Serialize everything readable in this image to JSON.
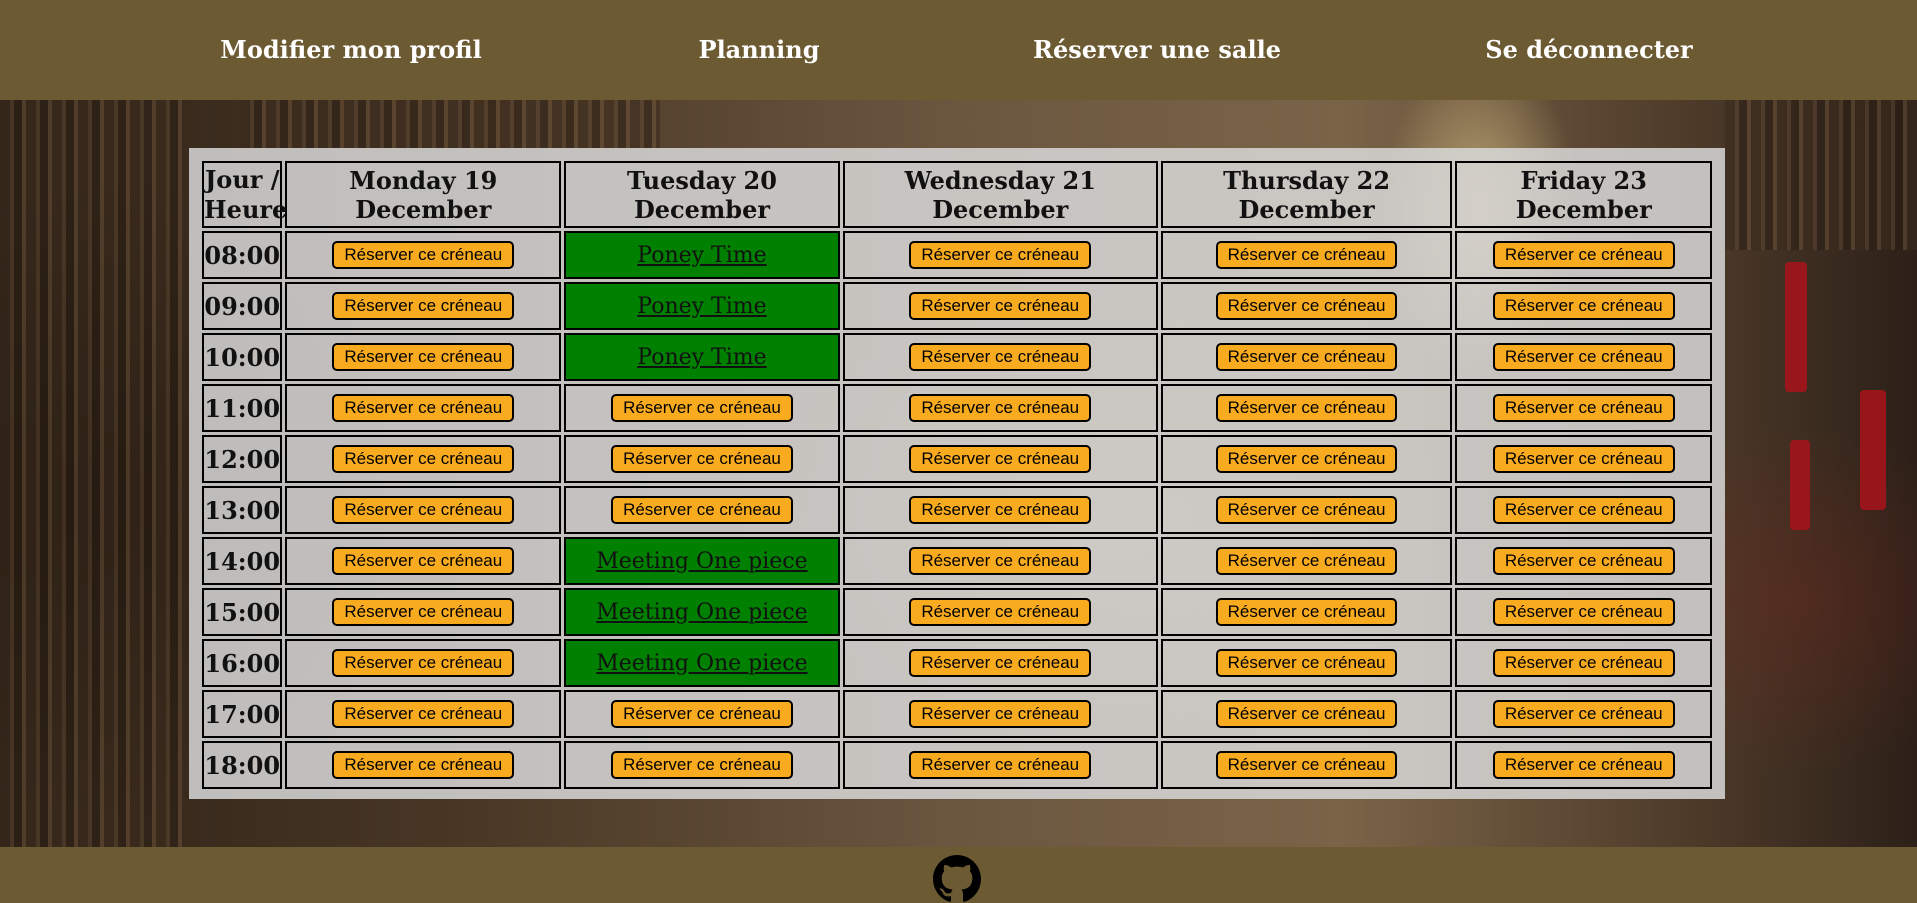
{
  "nav": {
    "items": [
      {
        "label": "Modifier mon profil"
      },
      {
        "label": "Planning"
      },
      {
        "label": "Réserver une salle"
      },
      {
        "label": "Se déconnecter"
      }
    ]
  },
  "planning": {
    "corner_label": "Jour / Heure",
    "days": [
      "Monday 19 December",
      "Tuesday 20 December",
      "Wednesday 21 December",
      "Thursday 22 December",
      "Friday 23 December"
    ],
    "reserve_label": "Réserver ce créneau",
    "booked_color": "#008000",
    "button_color": "#f9ab20",
    "rows": [
      {
        "hour": "08:00",
        "slots": [
          null,
          "Poney Time",
          null,
          null,
          null
        ]
      },
      {
        "hour": "09:00",
        "slots": [
          null,
          "Poney Time",
          null,
          null,
          null
        ]
      },
      {
        "hour": "10:00",
        "slots": [
          null,
          "Poney Time",
          null,
          null,
          null
        ]
      },
      {
        "hour": "11:00",
        "slots": [
          null,
          null,
          null,
          null,
          null
        ]
      },
      {
        "hour": "12:00",
        "slots": [
          null,
          null,
          null,
          null,
          null
        ]
      },
      {
        "hour": "13:00",
        "slots": [
          null,
          null,
          null,
          null,
          null
        ]
      },
      {
        "hour": "14:00",
        "slots": [
          null,
          "Meeting One piece",
          null,
          null,
          null
        ]
      },
      {
        "hour": "15:00",
        "slots": [
          null,
          "Meeting One piece",
          null,
          null,
          null
        ]
      },
      {
        "hour": "16:00",
        "slots": [
          null,
          "Meeting One piece",
          null,
          null,
          null
        ]
      },
      {
        "hour": "17:00",
        "slots": [
          null,
          null,
          null,
          null,
          null
        ]
      },
      {
        "hour": "18:00",
        "slots": [
          null,
          null,
          null,
          null,
          null
        ]
      }
    ]
  },
  "footer": {
    "icon": "github-icon"
  },
  "theme": {
    "header_bg": "#6c5a33"
  }
}
